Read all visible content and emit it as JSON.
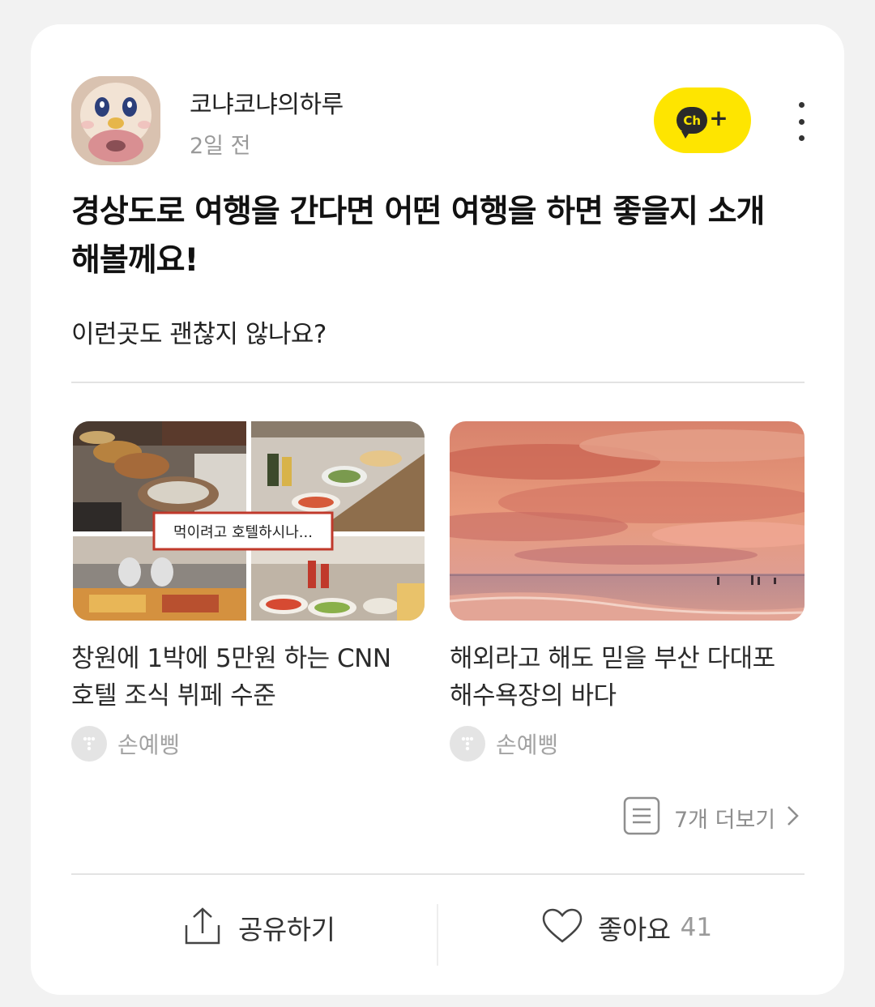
{
  "post": {
    "author": "코냐코냐의하루",
    "time": "2일 전",
    "title": "경상도로 여행을 간다면 어떤 여행을 하면 좋을지 소개해볼께요!",
    "subtitle": "이런곳도 괜찮지 않나요?",
    "channel_button": {
      "badge": "Ch",
      "plus": "+"
    }
  },
  "items": [
    {
      "title": "창원에 1박에 5만원 하는 CNN 호텔 조식 뷔페 수준",
      "thumb_caption": "먹이려고 호텔하시나...",
      "source": "손예삥"
    },
    {
      "title": "해외라고 해도 믿을 부산 다대포 해수욕장의 바다",
      "source": "손예삥"
    }
  ],
  "more_link": {
    "label": "7개 더보기"
  },
  "actions": {
    "share": "공유하기",
    "like": "좋아요",
    "like_count": "41"
  },
  "colors": {
    "channel_yellow": "#fee500",
    "background": "#f2f2f2",
    "card": "#ffffff"
  }
}
